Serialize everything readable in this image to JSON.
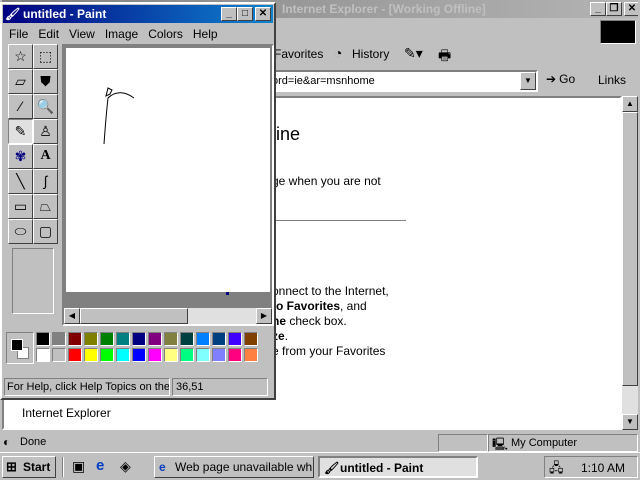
{
  "ie": {
    "title": "Internet Explorer - [Working Offline]",
    "toolbar": {
      "favorites": "Favorites",
      "history": "History"
    },
    "address_value": "ord=ie&ar=msnhome",
    "go_label": "Go",
    "links_label": "Links",
    "doc": {
      "heading_fragment": "line",
      "line1": "ge when you are not",
      "para1": "onnect to the Internet,",
      "para2a": "to Favorites",
      "para2b": ", and",
      "para3a": "ne",
      "para3b": " check box.",
      "para4": "ze",
      "para4b": ".",
      "para5": "e from your Favorites",
      "footer_link": "Internet Explorer"
    },
    "status": {
      "left": "Done",
      "zone": "My Computer"
    }
  },
  "paint": {
    "title": "untitled - Paint",
    "menu": [
      "File",
      "Edit",
      "View",
      "Image",
      "Colors",
      "Help"
    ],
    "status_help": "For Help, click Help Topics on the Help",
    "status_coords": "36,51",
    "palette_row1": [
      "#000000",
      "#808080",
      "#800000",
      "#808000",
      "#008000",
      "#008080",
      "#000080",
      "#800080",
      "#808040",
      "#004040",
      "#0080ff",
      "#004080",
      "#4000ff",
      "#804000"
    ],
    "palette_row2": [
      "#ffffff",
      "#c0c0c0",
      "#ff0000",
      "#ffff00",
      "#00ff00",
      "#00ffff",
      "#0000ff",
      "#ff00ff",
      "#ffff80",
      "#00ff80",
      "#80ffff",
      "#8080ff",
      "#ff0080",
      "#ff8040"
    ],
    "fg_color": "#000000",
    "bg_color": "#ffffff"
  },
  "taskbar": {
    "start": "Start",
    "buttons": [
      "Web page unavailable wh...",
      "untitled - Paint"
    ],
    "clock": "1:10 AM"
  }
}
